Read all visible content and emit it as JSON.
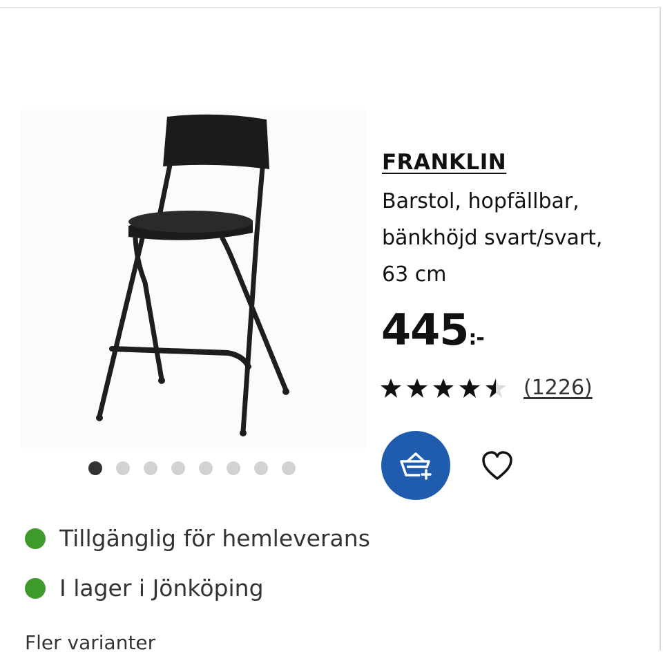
{
  "product": {
    "name": "FRANKLIN",
    "description": "Barstol, hopfällbar,\nbänkhöjd svart/svart,\n63 cm",
    "price": "445",
    "price_suffix": ":-",
    "rating": {
      "value": 4.5,
      "max": 5,
      "review_count": "(1226)"
    }
  },
  "gallery": {
    "image_icon": "bar-stool-image",
    "total_images": 8,
    "active_index": 0
  },
  "actions": {
    "add_to_cart_icon": "cart-add-icon",
    "wishlist_icon": "heart-icon"
  },
  "availability": [
    {
      "status_color": "#3d9a2b",
      "label": "Tillgänglig för hemleverans"
    },
    {
      "status_color": "#3d9a2b",
      "label": "I lager i Jönköping"
    }
  ],
  "more_variants_label": "Fler varianter",
  "colors": {
    "accent": "#1f5cad",
    "available": "#3d9a2b",
    "text": "#111111"
  }
}
